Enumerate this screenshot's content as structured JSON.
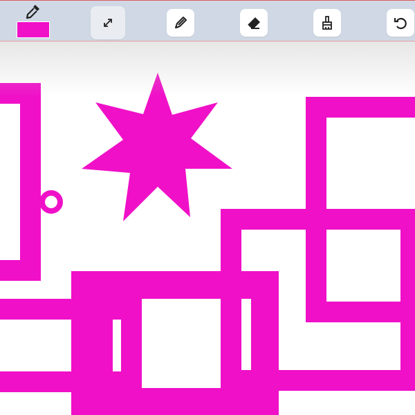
{
  "app": {
    "accent_color": "#f010c8",
    "toolbar_bg": "#cfd8e4"
  },
  "toolbar": {
    "tools": [
      {
        "name": "color-picker",
        "icon": "eyedropper-icon",
        "current_color": "#f010c8"
      },
      {
        "name": "move",
        "icon": "resize-arrows-icon",
        "active": true
      },
      {
        "name": "pen",
        "icon": "pen-icon"
      },
      {
        "name": "eraser",
        "icon": "eraser-icon"
      },
      {
        "name": "clear",
        "icon": "broom-icon"
      },
      {
        "name": "undo",
        "icon": "undo-icon"
      }
    ]
  },
  "canvas": {
    "stroke_color": "#f010c8",
    "shapes": [
      "rectangle",
      "rectangle",
      "rectangle",
      "rectangle",
      "rectangle",
      "rectangle",
      "rectangle",
      "rectangle",
      "star",
      "circle"
    ]
  }
}
